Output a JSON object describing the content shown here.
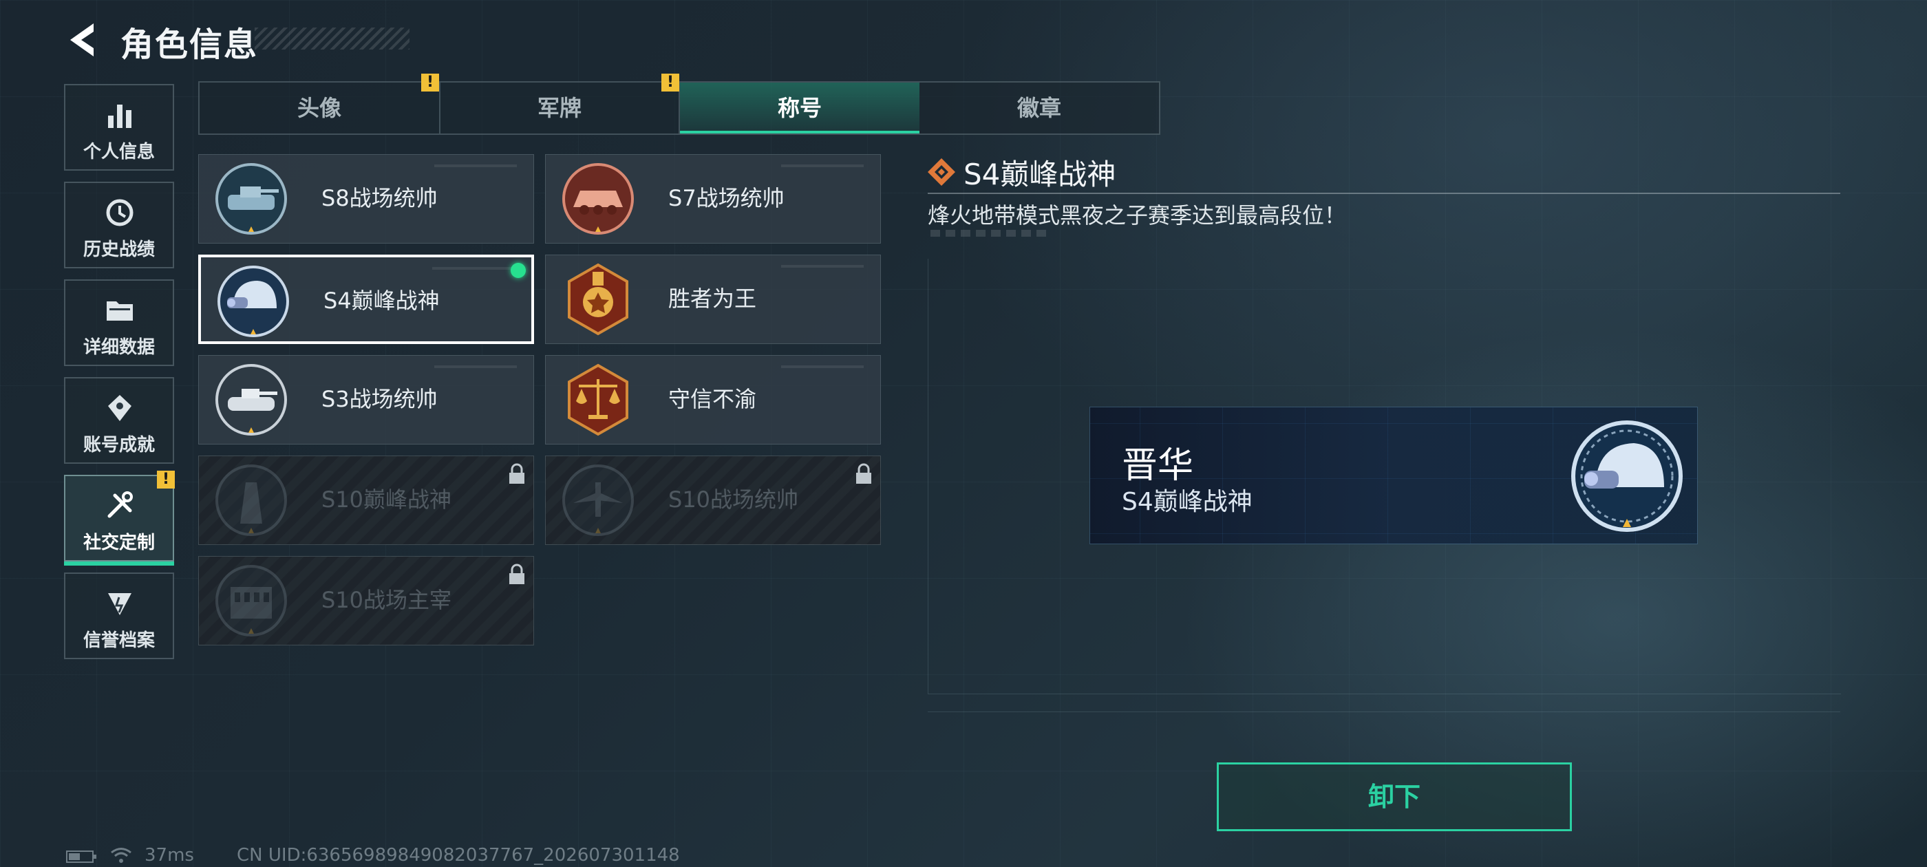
{
  "header": {
    "title": "角色信息"
  },
  "sidebar": {
    "items": [
      {
        "label": "个人信息",
        "icon": "bar-chart-icon"
      },
      {
        "label": "历史战绩",
        "icon": "history-icon"
      },
      {
        "label": "详细数据",
        "icon": "folder-icon"
      },
      {
        "label": "账号成就",
        "icon": "achievement-icon"
      },
      {
        "label": "社交定制",
        "icon": "tools-icon",
        "active": true,
        "alert": "!"
      },
      {
        "label": "信誉档案",
        "icon": "credit-icon"
      }
    ]
  },
  "tabs": [
    {
      "label": "头像",
      "alert": "!"
    },
    {
      "label": "军牌",
      "alert": "!"
    },
    {
      "label": "称号",
      "active": true
    },
    {
      "label": "徽章"
    }
  ],
  "titles": [
    {
      "name": "S8战场统帅",
      "emblem": "tank-emblem-icon",
      "locked": false
    },
    {
      "name": "S7战场统帅",
      "emblem": "apc-emblem-icon",
      "locked": false
    },
    {
      "name": "S4巅峰战神",
      "emblem": "helmet-emblem-icon",
      "locked": false,
      "selected": true
    },
    {
      "name": "胜者为王",
      "emblem": "medal-emblem-icon",
      "locked": false
    },
    {
      "name": "S3战场统帅",
      "emblem": "tank-emblem-icon",
      "locked": false
    },
    {
      "name": "守信不渝",
      "emblem": "scales-emblem-icon",
      "locked": false
    },
    {
      "name": "S10巅峰战神",
      "emblem": "tower-emblem-icon",
      "locked": true
    },
    {
      "name": "S10战场统帅",
      "emblem": "aircraft-emblem-icon",
      "locked": true
    },
    {
      "name": "S10战场主宰",
      "emblem": "colosseum-emblem-icon",
      "locked": true
    }
  ],
  "detail": {
    "title": "S4巅峰战神",
    "description": "烽火地带模式黑夜之子赛季达到最高段位！"
  },
  "preview": {
    "player_name": "晋华",
    "title": "S4巅峰战神"
  },
  "actions": {
    "unequip_label": "卸下"
  },
  "status": {
    "ping": "37ms",
    "uid": "CN UID:6365698984908203776​7_202607301148"
  },
  "colors": {
    "accent": "#2bd1a2",
    "warn": "#f2c037",
    "equipped_dot": "#27e08f"
  }
}
